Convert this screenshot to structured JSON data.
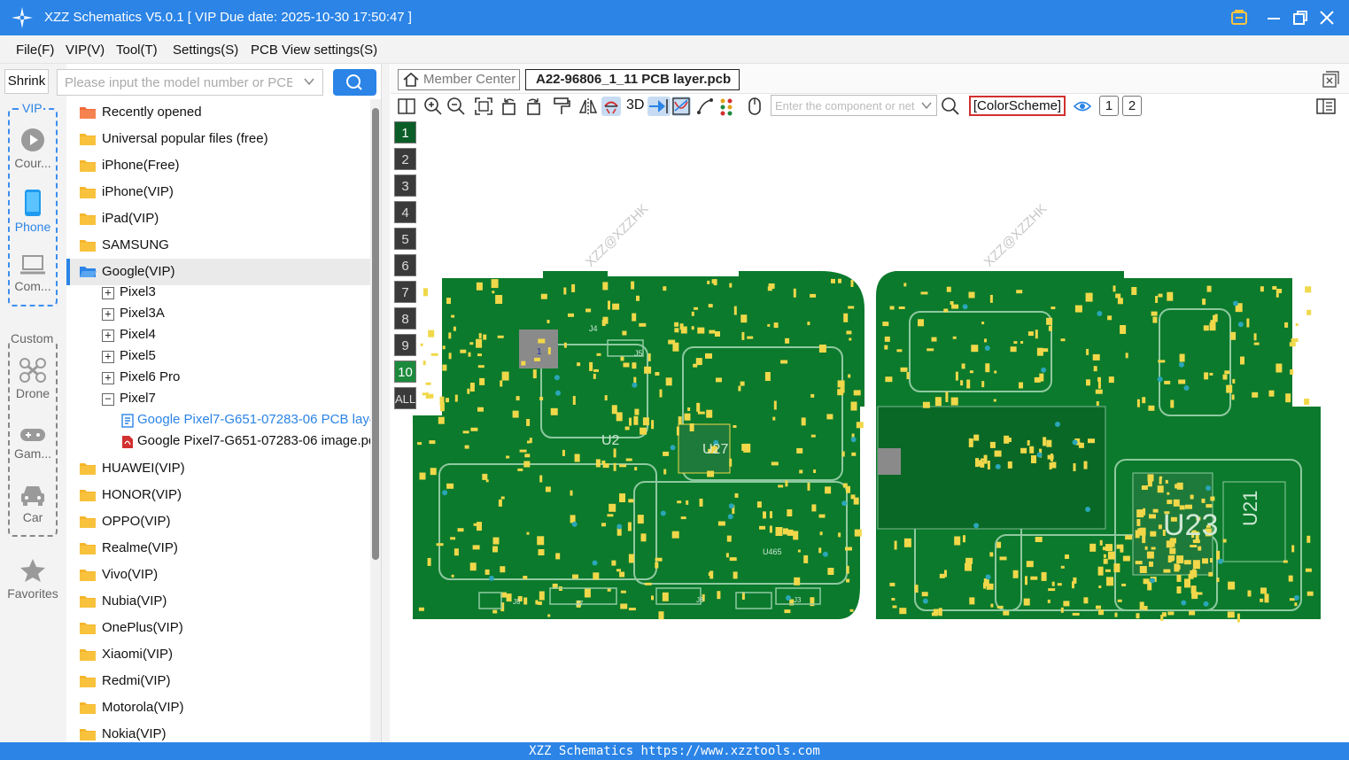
{
  "window": {
    "title": "XZZ Schematics V5.0.1 [ VIP Due date: 2025-10-30 17:50:47 ]",
    "controls": [
      "vip-badge-icon",
      "minimize-icon",
      "restore-icon",
      "close-icon"
    ]
  },
  "menu": [
    "File(F)",
    "VIP(V)",
    "Tool(T)",
    "Settings(S)",
    "PCB View settings(S)"
  ],
  "sidebar": {
    "shrink_label": "Shrink",
    "vip_group_label": "VIP",
    "vip_items": [
      {
        "label": "Cour...",
        "icon": "play-circle-icon"
      },
      {
        "label": "Phone",
        "icon": "phone-icon"
      },
      {
        "label": "Com...",
        "icon": "laptop-icon"
      }
    ],
    "custom_group_label": "Custom",
    "custom_items": [
      {
        "label": "Drone",
        "icon": "drone-icon"
      },
      {
        "label": "Gam...",
        "icon": "gamepad-icon"
      },
      {
        "label": "Car",
        "icon": "car-icon"
      }
    ],
    "favorites_label": "Favorites"
  },
  "search": {
    "placeholder": "Please input the model number or PCB"
  },
  "tree": {
    "folders_top": [
      "Recently opened",
      "Universal popular files (free)",
      "iPhone(Free)",
      "iPhone(VIP)",
      "iPad(VIP)",
      "SAMSUNG"
    ],
    "selected_folder": "Google(VIP)",
    "google_children": [
      {
        "label": "Pixel3",
        "expander": "+"
      },
      {
        "label": "Pixel3A",
        "expander": "+"
      },
      {
        "label": "Pixel4",
        "expander": "+"
      },
      {
        "label": "Pixel5",
        "expander": "+"
      },
      {
        "label": "Pixel6 Pro",
        "expander": "+"
      },
      {
        "label": "Pixel7",
        "expander": "−"
      }
    ],
    "pixel7_files": [
      {
        "label": "Google Pixel7-G651-07283-06 PCB layer.pcb",
        "type": "pcb"
      },
      {
        "label": "Google Pixel7-G651-07283-06 image.pdf",
        "type": "pdf"
      }
    ],
    "folders_bottom": [
      "HUAWEI(VIP)",
      "HONOR(VIP)",
      "OPPO(VIP)",
      "Realme(VIP)",
      "Vivo(VIP)",
      "Nubia(VIP)",
      "OnePlus(VIP)",
      "Xiaomi(VIP)",
      "Redmi(VIP)",
      "Motorola(VIP)",
      "Nokia(VIP)"
    ]
  },
  "tabs": {
    "member_center": "Member Center",
    "open_file": "A22-96806_1_11 PCB layer.pcb"
  },
  "toolbar": {
    "icons": [
      "split-view-icon",
      "zoom-in-icon",
      "zoom-out-icon",
      "fit-screen-icon",
      "rotate-left-icon",
      "rotate-right-icon",
      "format-paint-icon",
      "mirror-icon",
      "probe-icon"
    ],
    "three_d_label": "3D",
    "icons2": [
      "pin-arrow-icon",
      "net-highlight-icon",
      "trace-icon",
      "dots-icon",
      "mouse-icon"
    ],
    "component_placeholder": "Enter the component or net",
    "color_scheme": "[ColorScheme]",
    "layer_buttons": [
      "1",
      "2"
    ]
  },
  "layers": [
    "1",
    "2",
    "3",
    "4",
    "5",
    "6",
    "7",
    "8",
    "9",
    "10",
    "ALL"
  ],
  "pcb": {
    "watermark": "XZZ@XZZHK",
    "labels": [
      "U23",
      "U21",
      "U27",
      "U2",
      "J5",
      "J4",
      "J8",
      "J7",
      "J6",
      "J3",
      "U465",
      "1"
    ]
  },
  "colors": {
    "accent": "#2b84e6",
    "pcb_green": "#0b7a2c",
    "pcb_dark": "#06501b",
    "pad_yellow": "#f0d84a",
    "selected_layer": "#1c8a3c"
  },
  "status": "XZZ Schematics https://www.xzztools.com"
}
